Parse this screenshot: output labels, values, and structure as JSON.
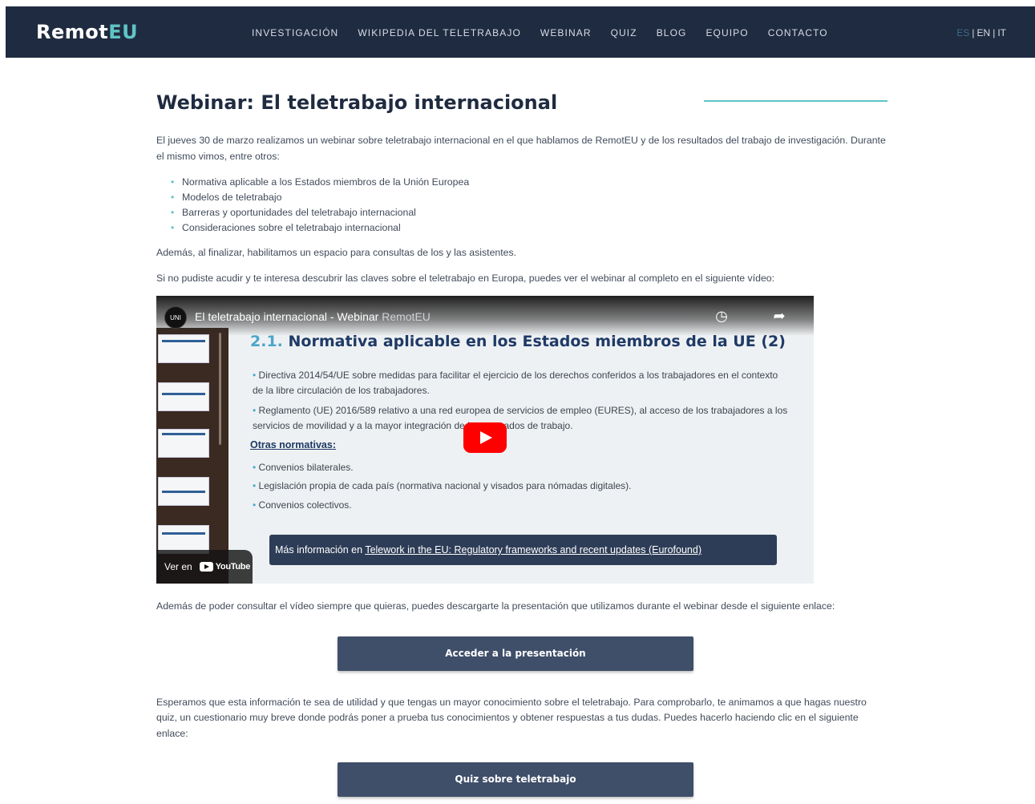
{
  "header": {
    "logo_part1": "Remot",
    "logo_part2": "EU",
    "nav": [
      "INVESTIGACIÓN",
      "WIKIPEDIA DEL TELETRABAJO",
      "WEBINAR",
      "QUIZ",
      "BLOG",
      "EQUIPO",
      "CONTACTO"
    ],
    "lang": {
      "es": "ES",
      "en": "EN",
      "it": "IT",
      "separator": "|"
    }
  },
  "main": {
    "title": "Webinar: El teletrabajo internacional",
    "intro": "El jueves 30 de marzo realizamos un webinar sobre teletrabajo internacional en el que hablamos de RemotEU y de los resultados del trabajo de investigación. Durante el mismo vimos, entre otros:",
    "topics": [
      "Normativa aplicable a los Estados miembros de la Unión Europea",
      "Modelos de teletrabajo",
      "Barreras y oportunidades del teletrabajo internacional",
      "Consideraciones sobre el teletrabajo internacional"
    ],
    "consultas": "Además, al finalizar, habilitamos un espacio para consultas de los y las asistentes.",
    "video_intro": "Si no pudiste acudir y te interesa descubrir las claves sobre el teletrabajo en Europa, puedes ver el webinar al completo en el siguiente vídeo:",
    "download_text": "Además de poder consultar el vídeo siempre que quieras, puedes descargarte la presentación que utilizamos durante el webinar desde el siguiente enlace:",
    "button_presentation": "Acceder a la presentación",
    "quiz_text": "Esperamos que esta información te sea de utilidad y que tengas un mayor conocimiento sobre el teletrabajo. Para comprobarlo, te animamos a que hagas nuestro quiz, un cuestionario muy breve donde podrás poner a prueba tus conocimientos y obtener respuestas a tus dudas. Puedes hacerlo haciendo clic en el siguiente enlace:",
    "button_quiz": "Quiz sobre teletrabajo"
  },
  "video": {
    "title": "El teletrabajo internacional - Webinar ",
    "title_channel": "RemotEU",
    "channel_avatar": "UNI",
    "slide_title_num": "2.1.",
    "slide_title": " Normativa aplicable en los Estados miembros de la UE (2)",
    "bullets": [
      "Directiva 2014/54/UE sobre medidas para facilitar el ejercicio de los derechos conferidos a los trabajadores en el contexto de la libre circulación de los trabajadores.",
      "Reglamento (UE) 2016/589 relativo a una red europea de servicios de empleo (EURES), al acceso de los trabajadores a los servicios de movilidad y a la mayor integración de los mercados de trabajo."
    ],
    "other_heading": "Otras normativas:",
    "other_items": [
      "Convenios bilaterales.",
      "Legislación propia de cada país (normativa nacional y visados para nómadas digitales).",
      "Convenios colectivos."
    ],
    "info_prefix": "Más información en ",
    "info_link": "Telework in the EU: Regulatory frameworks and recent updates (Eurofound)",
    "watch_on": "Ver en",
    "youtube": "YouTube"
  },
  "colors": {
    "header_bg": "#1f2b40",
    "accent": "#5fc4c4",
    "button_bg": "#3f4e69",
    "title": "#1f2b40",
    "play_red": "#ff0000"
  }
}
